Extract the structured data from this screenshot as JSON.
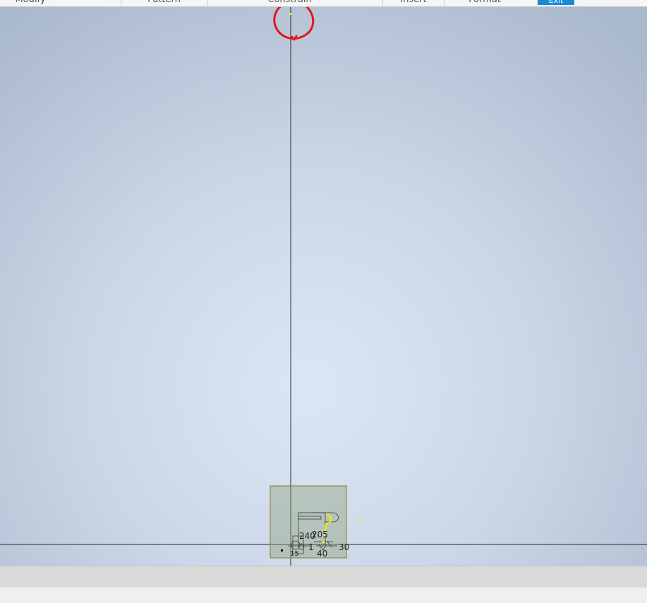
{
  "ribbon": {
    "groups": [
      {
        "label": "Modify"
      },
      {
        "label": "Pattern"
      },
      {
        "label": "Constrain"
      },
      {
        "label": "Insert"
      },
      {
        "label": "Format"
      }
    ],
    "finish_label": "Exit"
  },
  "sketch": {
    "dimensions": {
      "d240": "240",
      "d205": "205",
      "d30": "30",
      "d40": "40",
      "d1": "1",
      "d15": "15"
    }
  },
  "colors": {
    "annotation_red": "#e8141b",
    "sketch_yellow": "#f0f000",
    "selection_box": "#8a7a2a"
  }
}
